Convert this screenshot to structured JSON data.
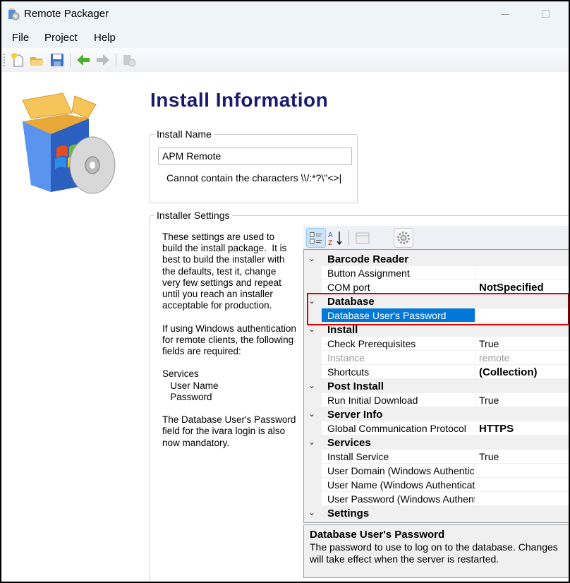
{
  "window": {
    "title": "Remote Packager"
  },
  "menu": [
    "File",
    "Project",
    "Help"
  ],
  "page": {
    "title": "Install Information"
  },
  "install_name": {
    "legend": "Install Name",
    "value": "APM Remote",
    "hint": "Cannot contain the characters \\\\/:*?\\\"<>|"
  },
  "installer_settings": {
    "legend": "Installer Settings",
    "help_text": "These settings are used to build the install package.  It is best to build the installer with the defaults, test it, change very few settings and repeat until you reach an installer acceptable for production.\n\nIf using Windows authentication for remote clients, the following fields are required:\n\nServices\n   User Name\n   Password\n\nThe Database User's Password field for the ivara login is also now mandatory."
  },
  "property_grid": {
    "rows": [
      {
        "type": "category",
        "name": "Barcode Reader"
      },
      {
        "type": "prop",
        "name": "Button Assignment",
        "value": ""
      },
      {
        "type": "prop",
        "name": "COM port",
        "value": "NotSpecified",
        "bold": true
      },
      {
        "type": "category",
        "name": "Database"
      },
      {
        "type": "prop",
        "name": "Database User's Password",
        "value": "",
        "selected": true
      },
      {
        "type": "category",
        "name": "Install"
      },
      {
        "type": "prop",
        "name": "Check Prerequisites",
        "value": "True"
      },
      {
        "type": "prop",
        "name": "Instance",
        "value": "remote",
        "disabled": true
      },
      {
        "type": "prop",
        "name": "Shortcuts",
        "value": "(Collection)",
        "bold": true
      },
      {
        "type": "category",
        "name": "Post Install"
      },
      {
        "type": "prop",
        "name": "Run Initial Download",
        "value": "True"
      },
      {
        "type": "category",
        "name": "Server Info"
      },
      {
        "type": "prop",
        "name": "Global Communication Protocol",
        "value": "HTTPS",
        "bold": true
      },
      {
        "type": "category",
        "name": "Services"
      },
      {
        "type": "prop",
        "name": "Install Service",
        "value": "True"
      },
      {
        "type": "prop",
        "name": "User Domain (Windows Authentication)",
        "value": ""
      },
      {
        "type": "prop",
        "name": "User Name (Windows Authentication)",
        "value": ""
      },
      {
        "type": "prop",
        "name": "User Password (Windows Authentication)",
        "value": ""
      },
      {
        "type": "category",
        "name": "Settings"
      }
    ],
    "description": {
      "title": "Database User's Password",
      "text": "The password to use to log on to the database.  Changes will take effect when the server is restarted."
    }
  },
  "colors": {
    "heading": "#1a1a6e",
    "selection": "#0078d7",
    "highlight_box": "#e00000"
  }
}
